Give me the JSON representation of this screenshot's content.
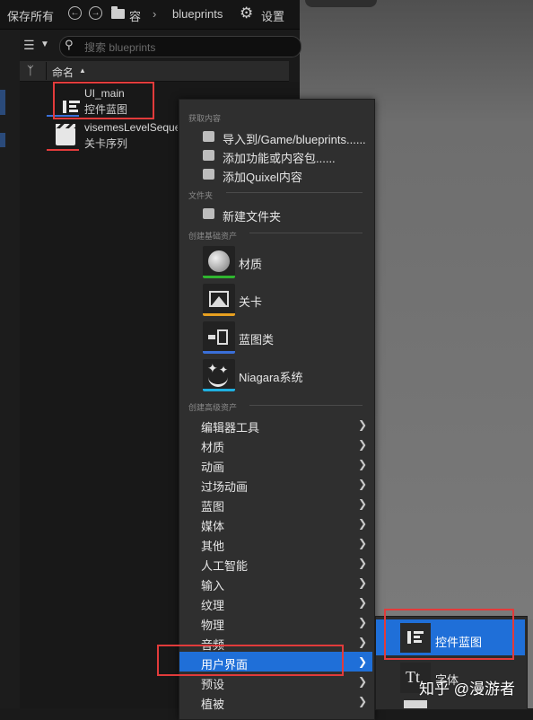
{
  "toolbar": {
    "save_all": "保存所有",
    "path_truncated": "容",
    "path_current": "blueprints",
    "settings": "设置"
  },
  "search": {
    "placeholder": "搜索 blueprints"
  },
  "column": {
    "name": "命名"
  },
  "assets": [
    {
      "name": "UI_main",
      "type": "控件蓝图",
      "icon": "widget-blueprint-icon"
    },
    {
      "name": "visemesLevelSeque",
      "type": "关卡序列",
      "icon": "level-sequence-icon"
    }
  ],
  "menu": {
    "sections": {
      "get_content": "获取内容",
      "folder": "文件夹",
      "basic_assets": "创建基础资产",
      "advanced_assets": "创建高级资产"
    },
    "get_content_items": [
      "导入到/Game/blueprints......",
      "添加功能或内容包......",
      "添加Quixel内容"
    ],
    "folder_items": [
      "新建文件夹"
    ],
    "basic_items": [
      {
        "label": "材质",
        "icon": "material-icon",
        "color": "#2fb52f"
      },
      {
        "label": "关卡",
        "icon": "level-icon",
        "color": "#e8a020"
      },
      {
        "label": "蓝图类",
        "icon": "blueprint-class-icon",
        "color": "#3a6fd8"
      },
      {
        "label": "Niagara系统",
        "icon": "niagara-icon",
        "color": "#1fb0e0"
      }
    ],
    "advanced_items": [
      "编辑器工具",
      "材质",
      "动画",
      "过场动画",
      "蓝图",
      "媒体",
      "其他",
      "人工智能",
      "输入",
      "纹理",
      "物理",
      "音频",
      "用户界面",
      "预设",
      "植被"
    ],
    "selected_item": "用户界面"
  },
  "submenu": {
    "items": [
      {
        "label": "控件蓝图",
        "icon": "widget-blueprint-icon"
      },
      {
        "label": "字体",
        "icon": "font-icon"
      }
    ]
  },
  "watermark": "知乎 @漫游者",
  "colors": {
    "accent": "#1f6fd8",
    "highlight_box": "#e23b3b"
  }
}
